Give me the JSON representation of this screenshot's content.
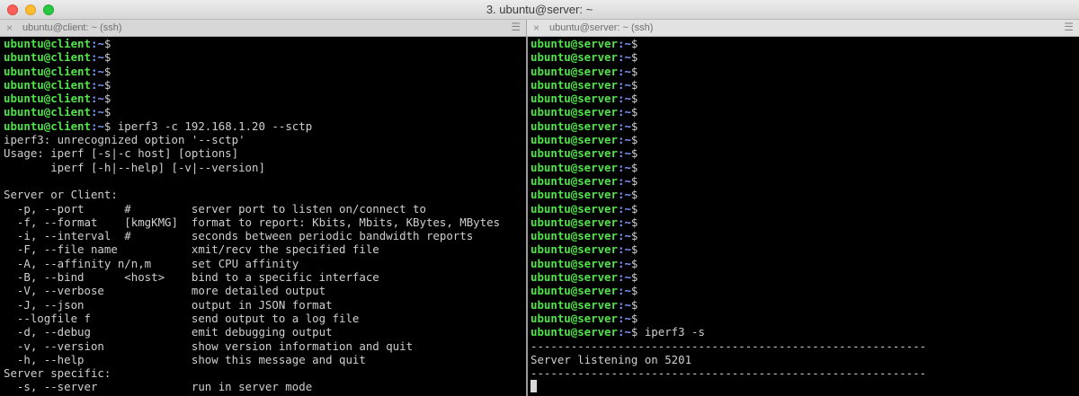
{
  "window": {
    "title": "3. ubuntu@server: ~"
  },
  "tabs": [
    {
      "label": "ubuntu@client: ~ (ssh)"
    },
    {
      "label": "ubuntu@server: ~ (ssh)"
    }
  ],
  "left_pane": {
    "user": "ubuntu",
    "host": "client",
    "path": ":~",
    "prompt_char": "$",
    "empty_prompts": 6,
    "command": " iperf3 -c 192.168.1.20 --sctp",
    "output": [
      "iperf3: unrecognized option '--sctp'",
      "Usage: iperf [-s|-c host] [options]",
      "       iperf [-h|--help] [-v|--version]",
      "",
      "Server or Client:",
      "  -p, --port      #         server port to listen on/connect to",
      "  -f, --format    [kmgKMG]  format to report: Kbits, Mbits, KBytes, MBytes",
      "  -i, --interval  #         seconds between periodic bandwidth reports",
      "  -F, --file name           xmit/recv the specified file",
      "  -A, --affinity n/n,m      set CPU affinity",
      "  -B, --bind      <host>    bind to a specific interface",
      "  -V, --verbose             more detailed output",
      "  -J, --json                output in JSON format",
      "  --logfile f               send output to a log file",
      "  -d, --debug               emit debugging output",
      "  -v, --version             show version information and quit",
      "  -h, --help                show this message and quit",
      "Server specific:",
      "  -s, --server              run in server mode"
    ]
  },
  "right_pane": {
    "user": "ubuntu",
    "host": "server",
    "path": ":~",
    "prompt_char": "$",
    "empty_prompts": 21,
    "command": " iperf3 -s",
    "output": [
      "-----------------------------------------------------------",
      "Server listening on 5201",
      "-----------------------------------------------------------"
    ]
  },
  "colors": {
    "prompt_user": "#52e24b",
    "prompt_path": "#7f9bff",
    "text": "#cfcfcf",
    "background": "#000000"
  },
  "icons": {
    "tab_close": "×",
    "tab_menu": "☰"
  }
}
